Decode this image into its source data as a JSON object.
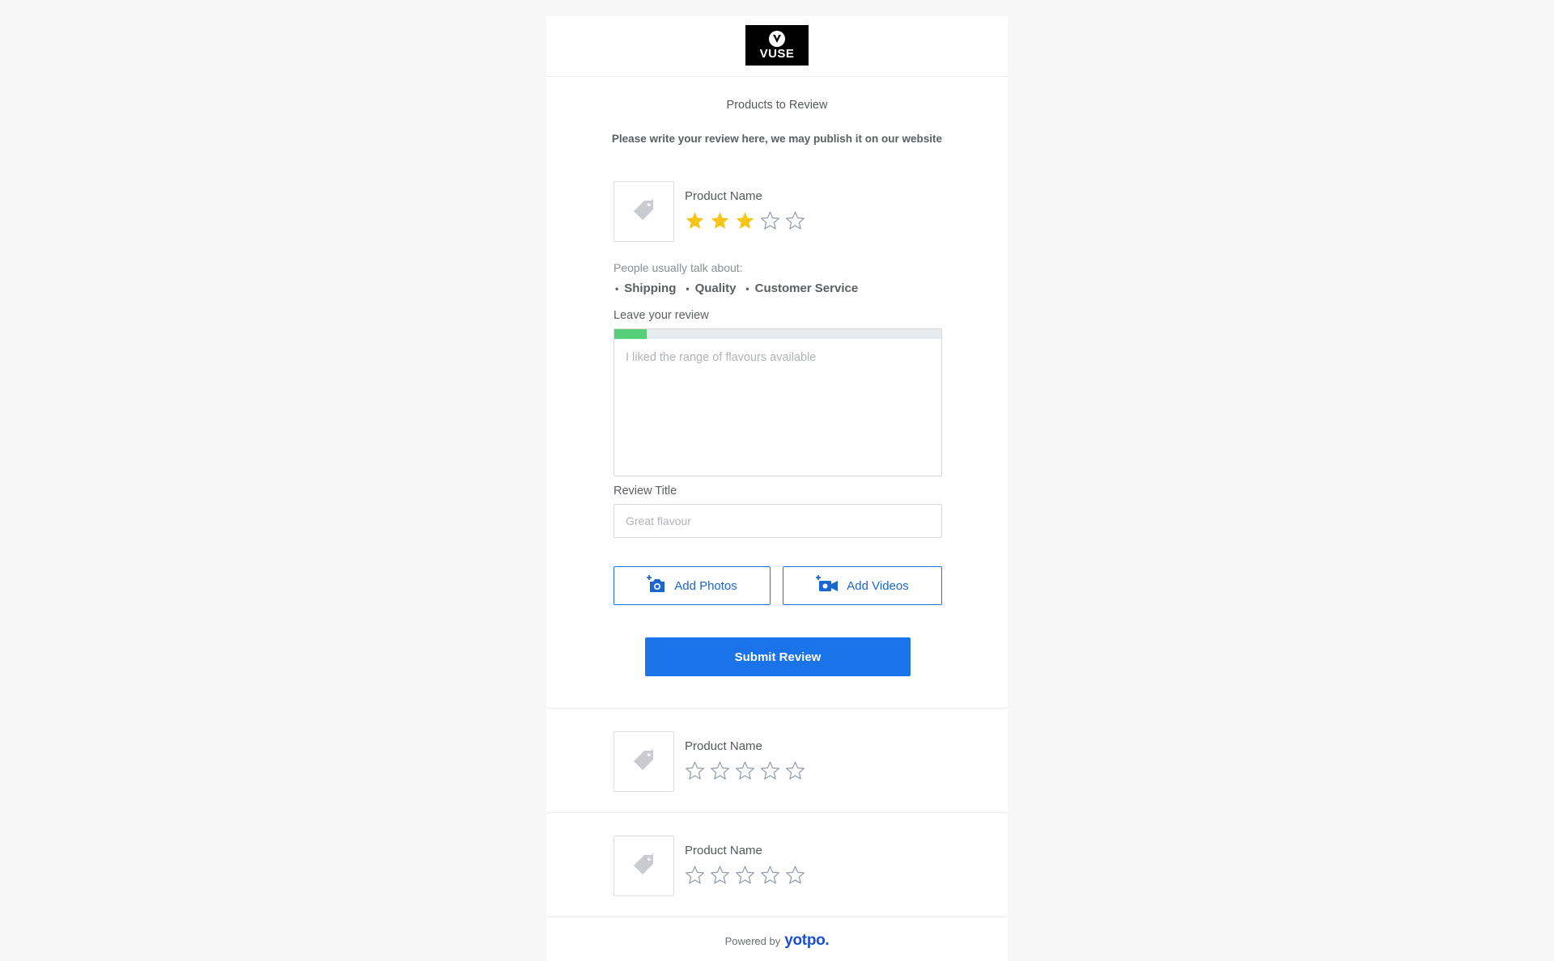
{
  "brand": {
    "logo_text": "VUSE"
  },
  "header": {
    "title": "Products to Review",
    "subtitle": "Please write your review here, we may publish it on our website"
  },
  "products": [
    {
      "name": "Product Name",
      "rating": 3,
      "max_rating": 5
    },
    {
      "name": "Product Name",
      "rating": 0,
      "max_rating": 5
    },
    {
      "name": "Product Name",
      "rating": 0,
      "max_rating": 5
    }
  ],
  "review_form": {
    "talk_label": "People usually talk about:",
    "topics": [
      "Shipping",
      "Quality",
      "Customer Service"
    ],
    "review_label": "Leave your review",
    "review_placeholder": "I liked the range of flavours available",
    "review_progress": 0.1,
    "title_label": "Review Title",
    "title_placeholder": "Great flavour",
    "add_photos_label": "Add Photos",
    "add_videos_label": "Add Videos",
    "submit_label": "Submit Review"
  },
  "footer": {
    "powered_by": "Powered by",
    "brand": "yotpo."
  },
  "colors": {
    "accent": "#1a73e8",
    "star_filled": "#f5c518",
    "star_empty": "#8e95aa",
    "progress": "#57cf78"
  }
}
